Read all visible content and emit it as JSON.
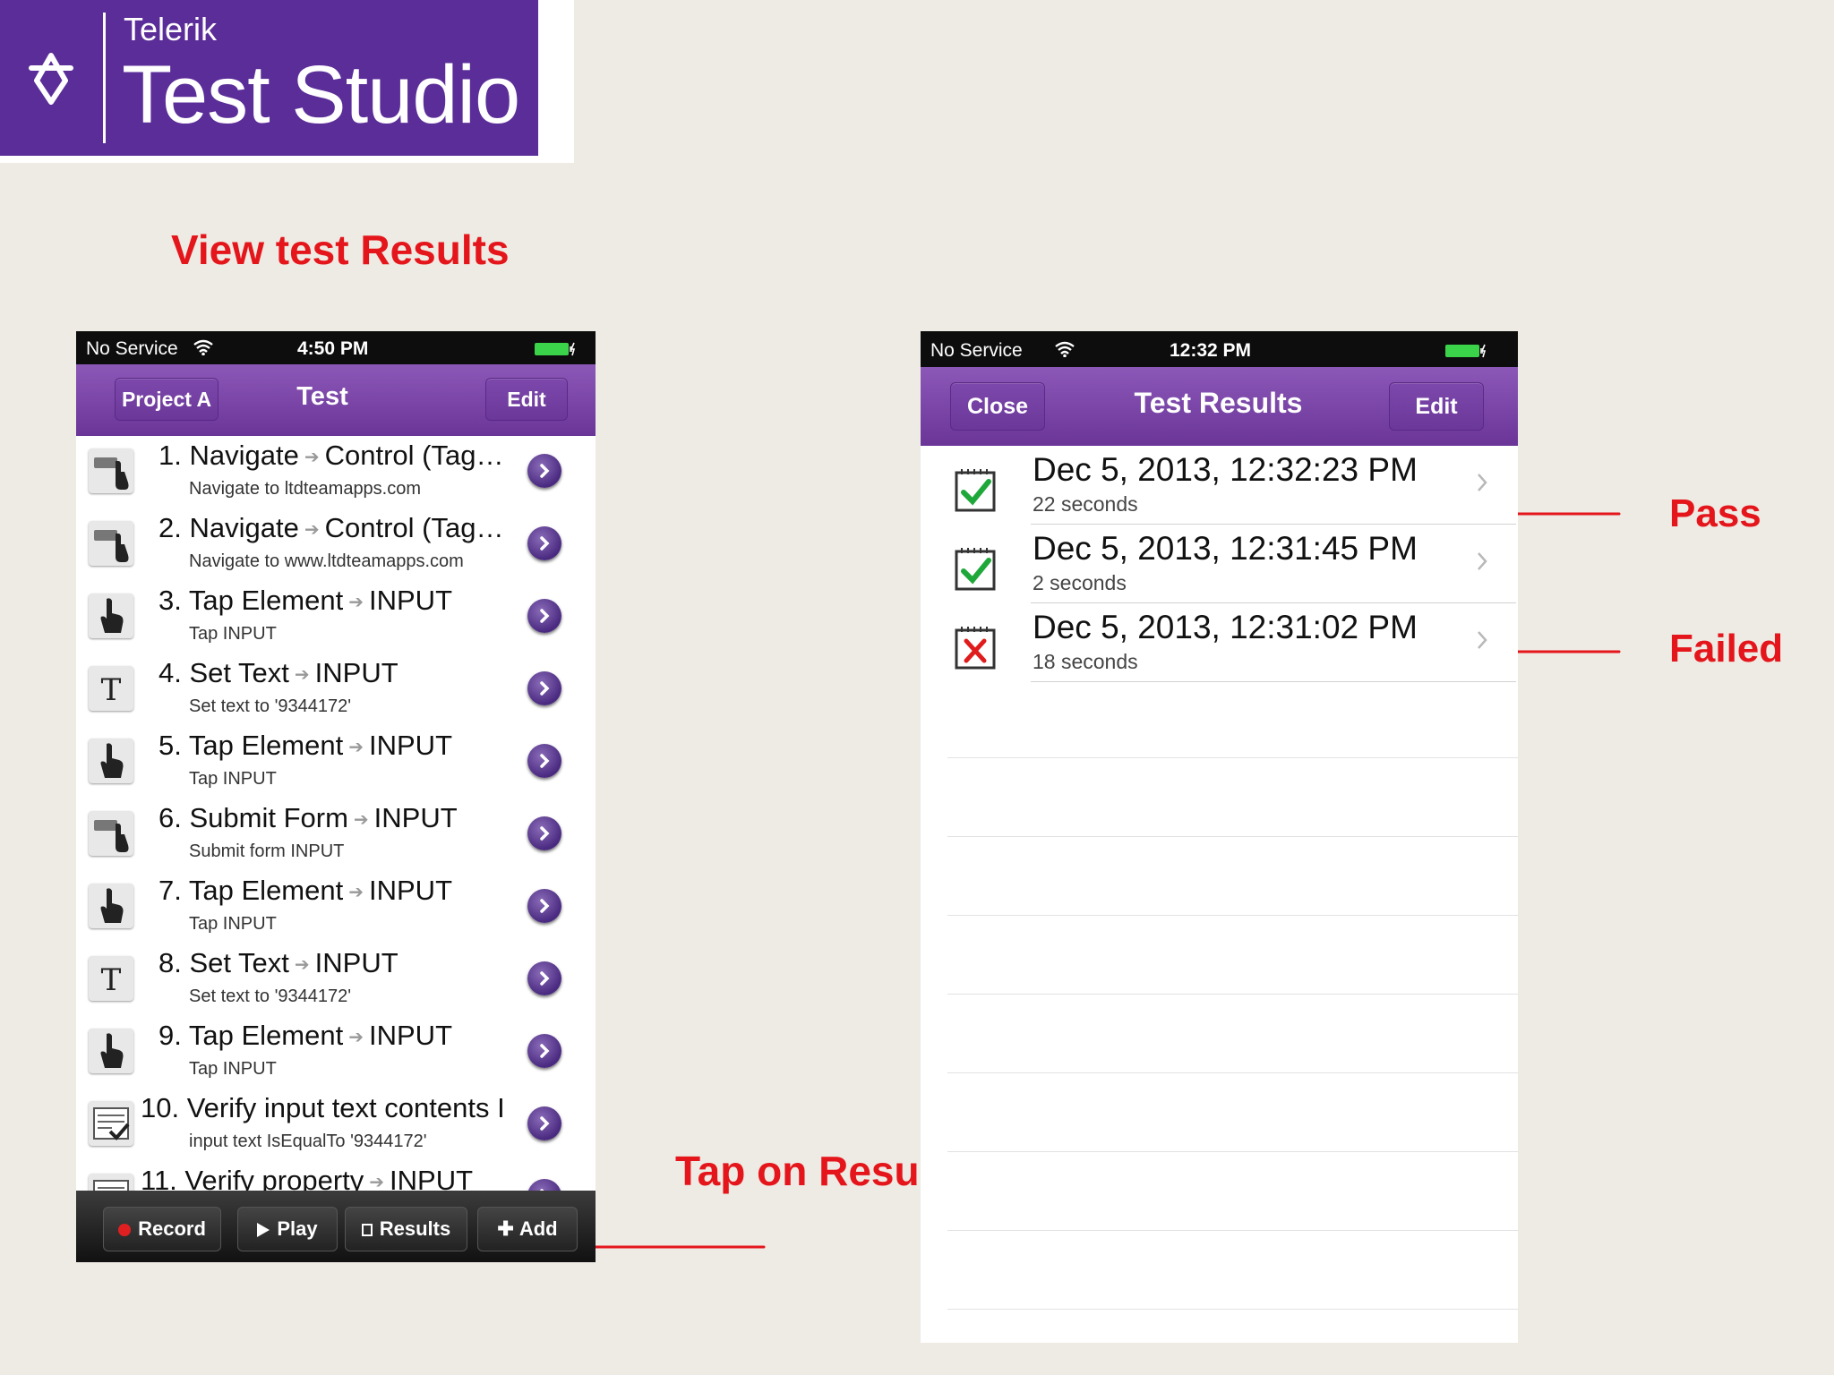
{
  "logo": {
    "brand": "Telerik",
    "product": "Test Studio"
  },
  "headings": {
    "view_results": "View test Results",
    "tap_results": "Tap on Results",
    "pass": "Pass",
    "failed": "Failed"
  },
  "left_phone": {
    "status": {
      "carrier": "No Service",
      "time": "4:50 PM"
    },
    "nav": {
      "back": "Project A",
      "title": "Test",
      "edit": "Edit"
    },
    "steps": [
      {
        "num": "1.",
        "action": "Navigate",
        "target": "Control (Tag…",
        "sub": "Navigate to ltdteamapps.com",
        "icon": "navigate-icon"
      },
      {
        "num": "2.",
        "action": "Navigate",
        "target": "Control (Tag…",
        "sub": "Navigate to www.ltdteamapps.com",
        "icon": "navigate-icon"
      },
      {
        "num": "3.",
        "action": "Tap Element",
        "target": "INPUT",
        "sub": "Tap INPUT",
        "icon": "tap-icon"
      },
      {
        "num": "4.",
        "action": "Set Text",
        "target": "INPUT",
        "sub": "Set text to '9344172'",
        "icon": "text-icon"
      },
      {
        "num": "5.",
        "action": "Tap Element",
        "target": "INPUT",
        "sub": "Tap INPUT",
        "icon": "tap-icon"
      },
      {
        "num": "6.",
        "action": "Submit Form",
        "target": "INPUT",
        "sub": "Submit form INPUT",
        "icon": "navigate-icon"
      },
      {
        "num": "7.",
        "action": "Tap Element",
        "target": "INPUT",
        "sub": "Tap INPUT",
        "icon": "tap-icon"
      },
      {
        "num": "8.",
        "action": "Set Text",
        "target": "INPUT",
        "sub": "Set text to '9344172'",
        "icon": "text-icon"
      },
      {
        "num": "9.",
        "action": "Tap Element",
        "target": "INPUT",
        "sub": "Tap INPUT",
        "icon": "tap-icon"
      },
      {
        "num": "10.",
        "action": "Verify input text contents",
        "target": "I",
        "sub": "input text IsEqualTo '9344172'",
        "icon": "verify-icon"
      },
      {
        "num": "11.",
        "action": "Verify property",
        "target": "INPUT",
        "sub": "",
        "icon": "verify-icon"
      }
    ],
    "toolbar": {
      "record": "Record",
      "play": "Play",
      "results": "Results",
      "add": "Add"
    }
  },
  "right_phone": {
    "status": {
      "carrier": "No Service",
      "time": "12:32 PM"
    },
    "nav": {
      "close": "Close",
      "title": "Test Results",
      "edit": "Edit"
    },
    "results": [
      {
        "date": "Dec 5, 2013, 12:32:23 PM",
        "duration": "22 seconds",
        "status": "pass"
      },
      {
        "date": "Dec 5, 2013, 12:31:45 PM",
        "duration": "2 seconds",
        "status": "pass"
      },
      {
        "date": "Dec 5, 2013, 12:31:02 PM",
        "duration": "18 seconds",
        "status": "failed"
      }
    ]
  },
  "colors": {
    "brand_purple": "#5b2d98",
    "annotation_red": "#e4161b",
    "pass_green": "#1fa83a",
    "fail_red": "#e01b1b"
  }
}
